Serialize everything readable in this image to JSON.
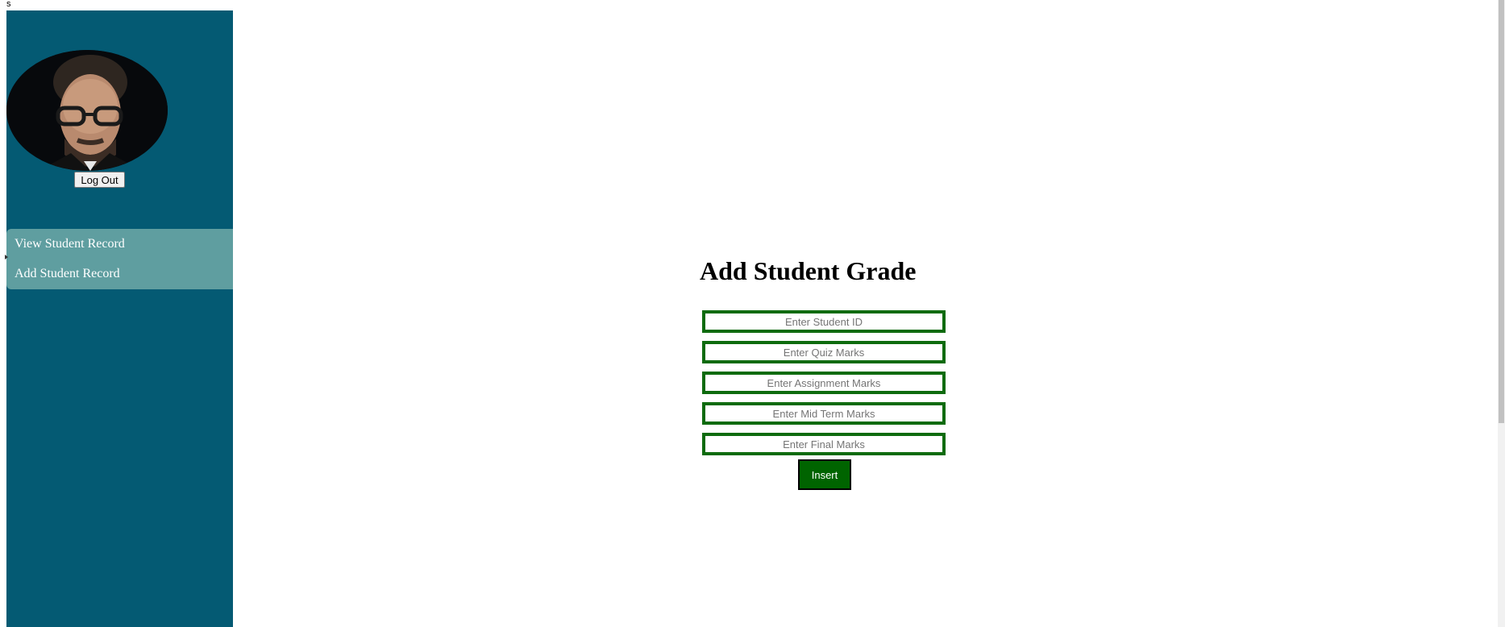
{
  "top_text": "s",
  "sidebar": {
    "logout_label": "Log Out",
    "avatar_icon": "person-avatar-icon",
    "nav_items": [
      {
        "label": "View Student Record"
      },
      {
        "label": "Add Student Record"
      }
    ]
  },
  "main": {
    "title": "Add Student Grade",
    "fields": {
      "student_id": {
        "placeholder": "Enter Student ID",
        "value": ""
      },
      "quiz": {
        "placeholder": "Enter Quiz Marks",
        "value": ""
      },
      "assignment": {
        "placeholder": "Enter Assignment Marks",
        "value": ""
      },
      "midterm": {
        "placeholder": "Enter Mid Term Marks",
        "value": ""
      },
      "final": {
        "placeholder": "Enter Final Marks",
        "value": ""
      }
    },
    "insert_label": "Insert"
  },
  "colors": {
    "sidebar_bg": "#045a73",
    "nav_bg": "#5f9ea0",
    "field_border": "#0e6b0e",
    "button_bg": "#006400"
  }
}
